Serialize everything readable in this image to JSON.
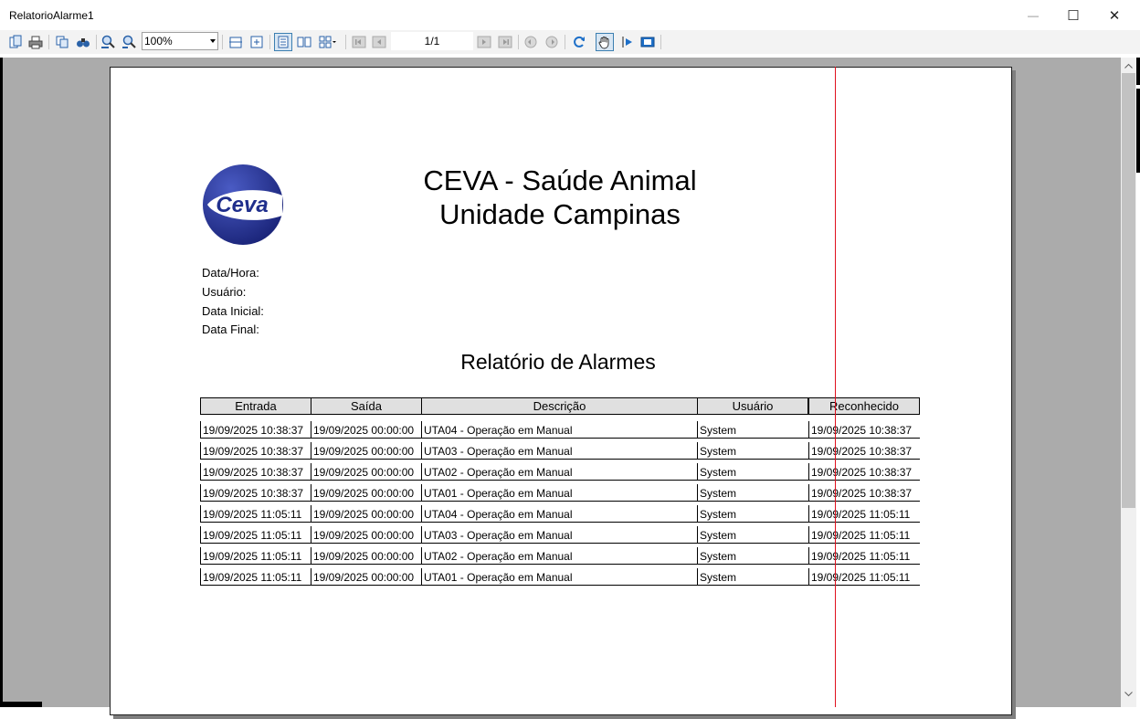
{
  "window": {
    "title": "RelatorioAlarme1",
    "controls": {
      "minimize": "—",
      "maximize": "☐",
      "close": "✕"
    }
  },
  "toolbar": {
    "zoom_value": "100%",
    "page_indicator": "1/1",
    "icons": [
      "open-icon",
      "print-icon",
      "copy-icon",
      "find-icon",
      "zoom-in-icon",
      "zoom-out-icon",
      "page-width-icon",
      "whole-page-icon",
      "single-page-icon",
      "multi-page-icon",
      "grid-icon",
      "first-page-icon",
      "prev-page-icon",
      "next-page-icon",
      "last-page-icon",
      "back-icon",
      "forward-icon",
      "refresh-icon",
      "hand-icon",
      "select-icon",
      "export-icon"
    ]
  },
  "report": {
    "company_line1": "CEVA - Saúde Animal",
    "company_line2": "Unidade Campinas",
    "logo_text": "Ceva",
    "fields": {
      "datetime": "Data/Hora:",
      "user": "Usuário:",
      "start_date": "Data Inicial:",
      "end_date": "Data Final:"
    },
    "title": "Relatório de Alarmes",
    "columns": [
      "Entrada",
      "Saída",
      "Descrição",
      "Usuário",
      "Reconhecido"
    ],
    "rows": [
      [
        "19/09/2025 10:38:37",
        "19/09/2025 00:00:00",
        "UTA04 - Operação em Manual",
        "System",
        "19/09/2025 10:38:37"
      ],
      [
        "19/09/2025 10:38:37",
        "19/09/2025 00:00:00",
        "UTA03 - Operação em Manual",
        "System",
        "19/09/2025 10:38:37"
      ],
      [
        "19/09/2025 10:38:37",
        "19/09/2025 00:00:00",
        "UTA02 - Operação em Manual",
        "System",
        "19/09/2025 10:38:37"
      ],
      [
        "19/09/2025 10:38:37",
        "19/09/2025 00:00:00",
        "UTA01 - Operação em Manual",
        "System",
        "19/09/2025 10:38:37"
      ],
      [
        "19/09/2025 11:05:11",
        "19/09/2025 00:00:00",
        "UTA04 - Operação em Manual",
        "System",
        "19/09/2025 11:05:11"
      ],
      [
        "19/09/2025 11:05:11",
        "19/09/2025 00:00:00",
        "UTA03 - Operação em Manual",
        "System",
        "19/09/2025 11:05:11"
      ],
      [
        "19/09/2025 11:05:11",
        "19/09/2025 00:00:00",
        "UTA02 - Operação em Manual",
        "System",
        "19/09/2025 11:05:11"
      ],
      [
        "19/09/2025 11:05:11",
        "19/09/2025 00:00:00",
        "UTA01 - Operação em Manual",
        "System",
        "19/09/2025 11:05:11"
      ]
    ]
  },
  "colors": {
    "logo_blue": "#1f2e8c",
    "header_fill": "#e0e0e0",
    "cursor_line": "#e0101e",
    "preview_bg": "#ababab"
  }
}
